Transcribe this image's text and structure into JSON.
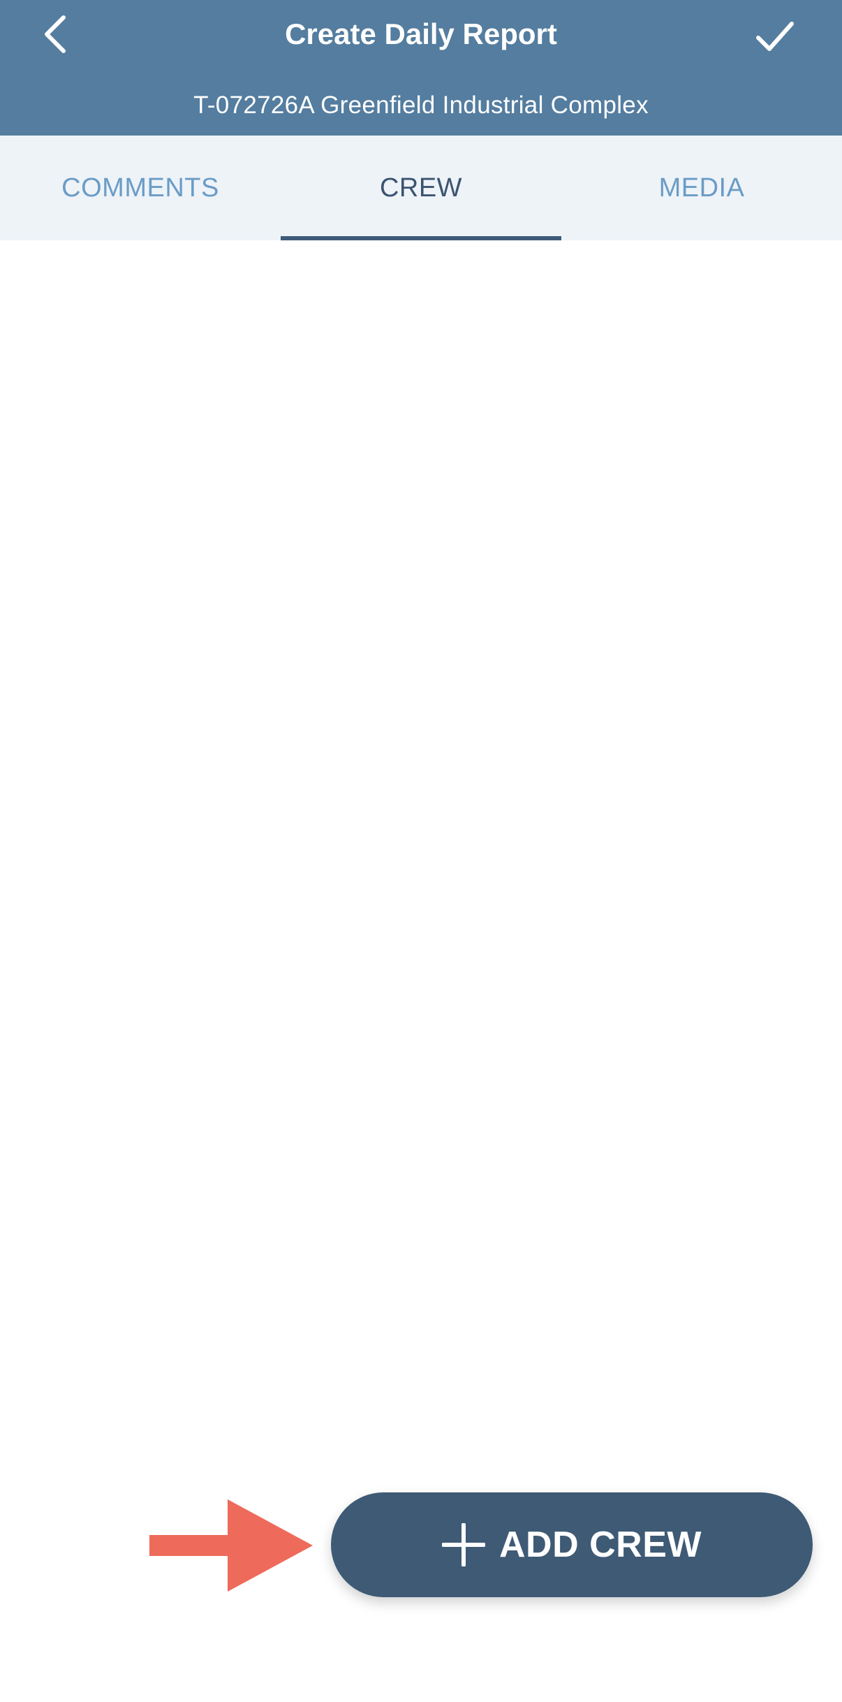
{
  "header": {
    "title": "Create Daily Report",
    "subtitle": "T-072726A Greenfield Industrial Complex",
    "back_icon": "chevron-left-icon",
    "confirm_icon": "checkmark-icon"
  },
  "tabs": [
    {
      "label": "COMMENTS",
      "active": false
    },
    {
      "label": "CREW",
      "active": true
    },
    {
      "label": "MEDIA",
      "active": false
    }
  ],
  "add_crew_button": {
    "label": "ADD CREW",
    "icon": "plus-icon"
  },
  "annotation": {
    "icon": "arrow-right-icon",
    "color": "#ee6a5a"
  },
  "colors": {
    "header_bg": "#547d9f",
    "tab_bar_bg": "#eef3f8",
    "tab_inactive": "#6a9cc6",
    "tab_active": "#3b5470",
    "button_bg": "#3e5a75"
  }
}
